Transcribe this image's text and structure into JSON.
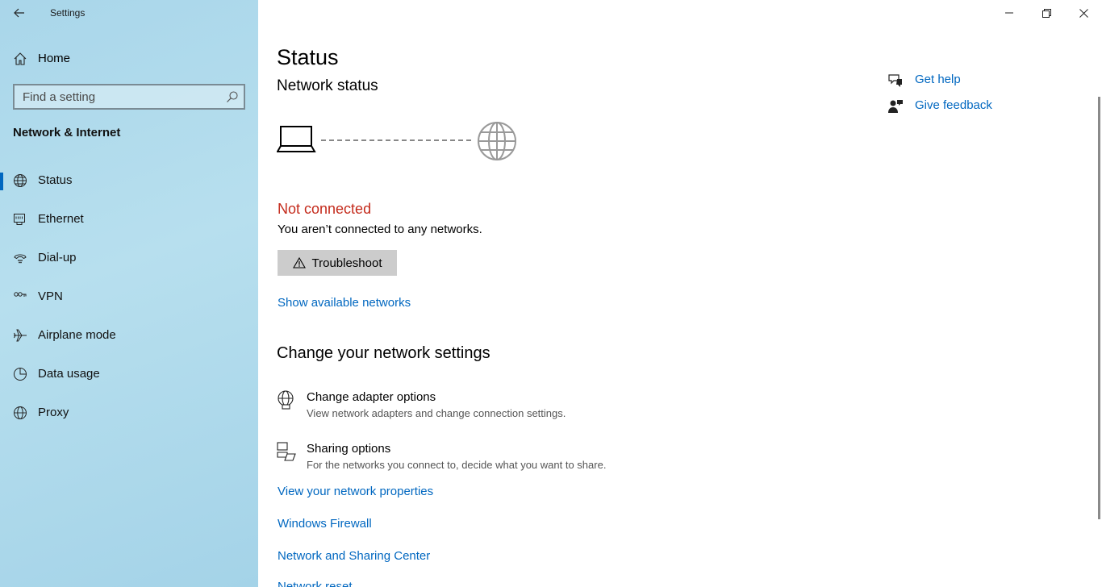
{
  "window": {
    "app_title": "Settings"
  },
  "sidebar": {
    "home_label": "Home",
    "search_placeholder": "Find a setting",
    "section_title": "Network & Internet",
    "items": [
      {
        "label": "Status",
        "icon": "globe-status-icon",
        "active": true
      },
      {
        "label": "Ethernet",
        "icon": "ethernet-icon"
      },
      {
        "label": "Dial-up",
        "icon": "dialup-icon"
      },
      {
        "label": "VPN",
        "icon": "vpn-icon"
      },
      {
        "label": "Airplane mode",
        "icon": "airplane-icon"
      },
      {
        "label": "Data usage",
        "icon": "data-usage-icon"
      },
      {
        "label": "Proxy",
        "icon": "globe-icon"
      }
    ]
  },
  "main": {
    "title": "Status",
    "subtitle": "Network status",
    "connection_status": "Not connected",
    "connection_desc": "You aren’t connected to any networks.",
    "troubleshoot_label": "Troubleshoot",
    "show_networks_link": "Show available networks",
    "change_heading": "Change your network settings",
    "options": [
      {
        "title": "Change adapter options",
        "desc": "View network adapters and change connection settings.",
        "icon": "adapter-icon"
      },
      {
        "title": "Sharing options",
        "desc": "For the networks you connect to, decide what you want to share.",
        "icon": "sharing-icon"
      }
    ],
    "links": [
      "View your network properties",
      "Windows Firewall",
      "Network and Sharing Center",
      "Network reset"
    ]
  },
  "help": {
    "get_help": "Get help",
    "give_feedback": "Give feedback"
  },
  "colors": {
    "accent": "#0067c0",
    "error": "#c42b1c",
    "sidebar_bg": "#b0dbed"
  }
}
